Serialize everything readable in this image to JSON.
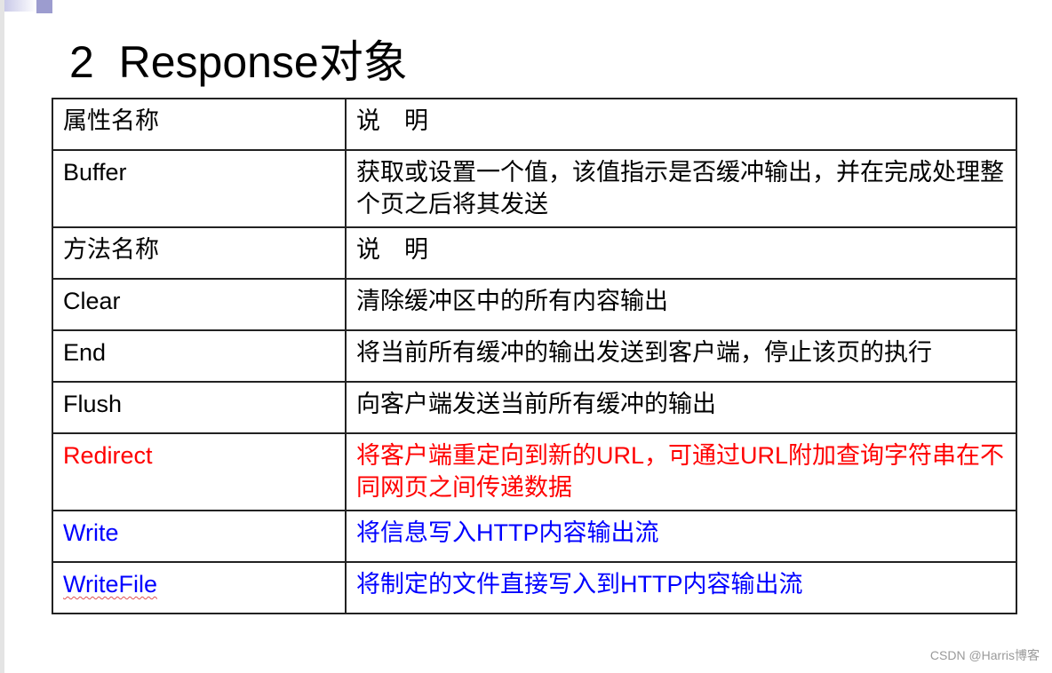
{
  "slide": {
    "title": "2  Response对象"
  },
  "table": {
    "rows": [
      {
        "name": "属性名称",
        "desc": "说　明",
        "type": "header",
        "color": "#000000"
      },
      {
        "name": "Buffer",
        "desc": "获取或设置一个值，该值指示是否缓冲输出，并在完成处理整个页之后将其发送",
        "type": "property",
        "color": "#000000"
      },
      {
        "name": "方法名称",
        "desc": "说　明",
        "type": "header",
        "color": "#000000"
      },
      {
        "name": "Clear",
        "desc": "清除缓冲区中的所有内容输出",
        "type": "method",
        "color": "#000000"
      },
      {
        "name": "End",
        "desc": "将当前所有缓冲的输出发送到客户端，停止该页的执行",
        "type": "method",
        "color": "#000000"
      },
      {
        "name": "Flush",
        "desc": "向客户端发送当前所有缓冲的输出",
        "type": "method",
        "color": "#000000"
      },
      {
        "name": "Redirect",
        "desc": "将客户端重定向到新的URL，可通过URL附加查询字符串在不同网页之间传递数据",
        "type": "method",
        "color": "#ff0000"
      },
      {
        "name": "Write",
        "desc": "将信息写入HTTP内容输出流",
        "type": "method",
        "color": "#0000ff"
      },
      {
        "name": "WriteFile",
        "desc": "将制定的文件直接写入到HTTP内容输出流",
        "type": "method",
        "color": "#0000ff"
      }
    ]
  },
  "watermark": "CSDN @Harris博客"
}
